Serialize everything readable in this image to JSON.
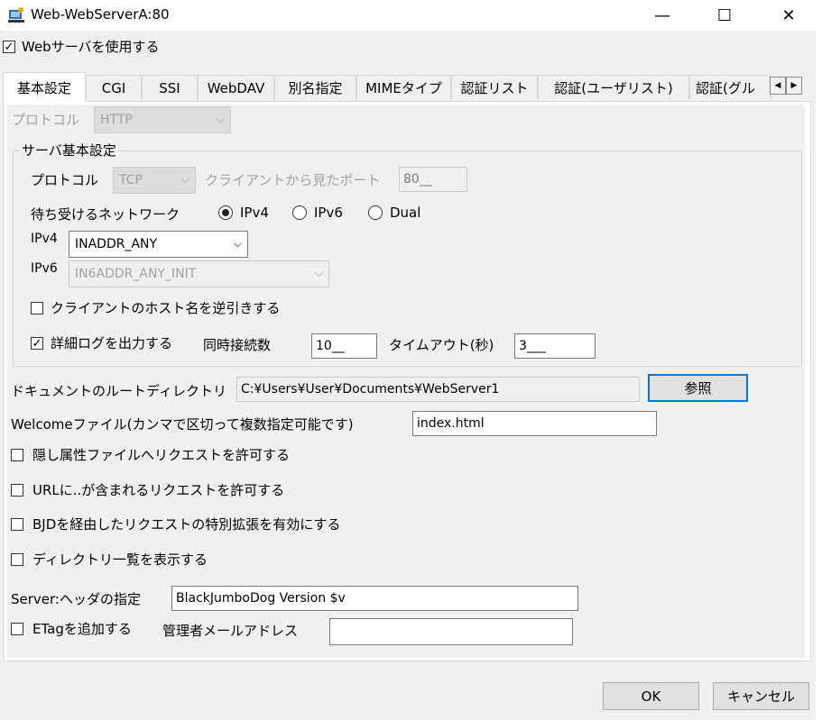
{
  "window": {
    "title": "Web-WebServerA:80",
    "minimize": "—",
    "maximize": "☐",
    "close": "✕"
  },
  "use_web_server": {
    "label": "Webサーバを使用する",
    "checked": true
  },
  "tabs": [
    {
      "label": "基本設定"
    },
    {
      "label": "CGI"
    },
    {
      "label": "SSI"
    },
    {
      "label": "WebDAV"
    },
    {
      "label": "別名指定"
    },
    {
      "label": "MIMEタイプ"
    },
    {
      "label": "認証リスト"
    },
    {
      "label": "認証(ユーザリスト)"
    },
    {
      "label": "認証(グル"
    }
  ],
  "tab_scroll": {
    "left": "◀",
    "right": "▶"
  },
  "protocol_top": {
    "label": "プロトコル",
    "value": "HTTP"
  },
  "server_basic": {
    "title": "サーバ基本設定",
    "protocol_label": "プロトコル",
    "protocol_value": "TCP",
    "client_port_label": "クライアントから見たポート",
    "client_port_value": "80__",
    "listen_network_label": "待ち受けるネットワーク",
    "radio_ipv4": "IPv4",
    "radio_ipv6": "IPv6",
    "radio_dual": "Dual",
    "ipv4_label": "IPv4",
    "ipv4_value": "INADDR_ANY",
    "ipv6_label": "IPv6",
    "ipv6_value": "IN6ADDR_ANY_INIT",
    "reverse_lookup_label": "クライアントのホスト名を逆引きする",
    "detail_log_label": "詳細ログを出力する",
    "concurrent_label": "同時接続数",
    "concurrent_value": "10__",
    "timeout_label": "タイムアウト(秒)",
    "timeout_value": "3___"
  },
  "doc_root": {
    "label": "ドキュメントのルートディレクトリ",
    "value": "C:¥Users¥User¥Documents¥WebServer1",
    "browse": "参照"
  },
  "welcome": {
    "label": "Welcomeファイル(カンマで区切って複数指定可能です)",
    "value": "index.html"
  },
  "options": {
    "hidden_files": "隠し属性ファイルへリクエストを許可する",
    "url_dots": "URLに..が含まれるリクエストを許可する",
    "bjd_ext": "BJDを経由したリクエストの特別拡張を有効にする",
    "dir_list": "ディレクトリ一覧を表示する"
  },
  "server_header": {
    "label": "Server:ヘッダの指定",
    "value": "BlackJumboDog Version $v"
  },
  "etag": {
    "label": "ETagを追加する"
  },
  "admin_mail": {
    "label": "管理者メールアドレス",
    "value": ""
  },
  "buttons": {
    "ok": "OK",
    "cancel": "キャンセル"
  }
}
